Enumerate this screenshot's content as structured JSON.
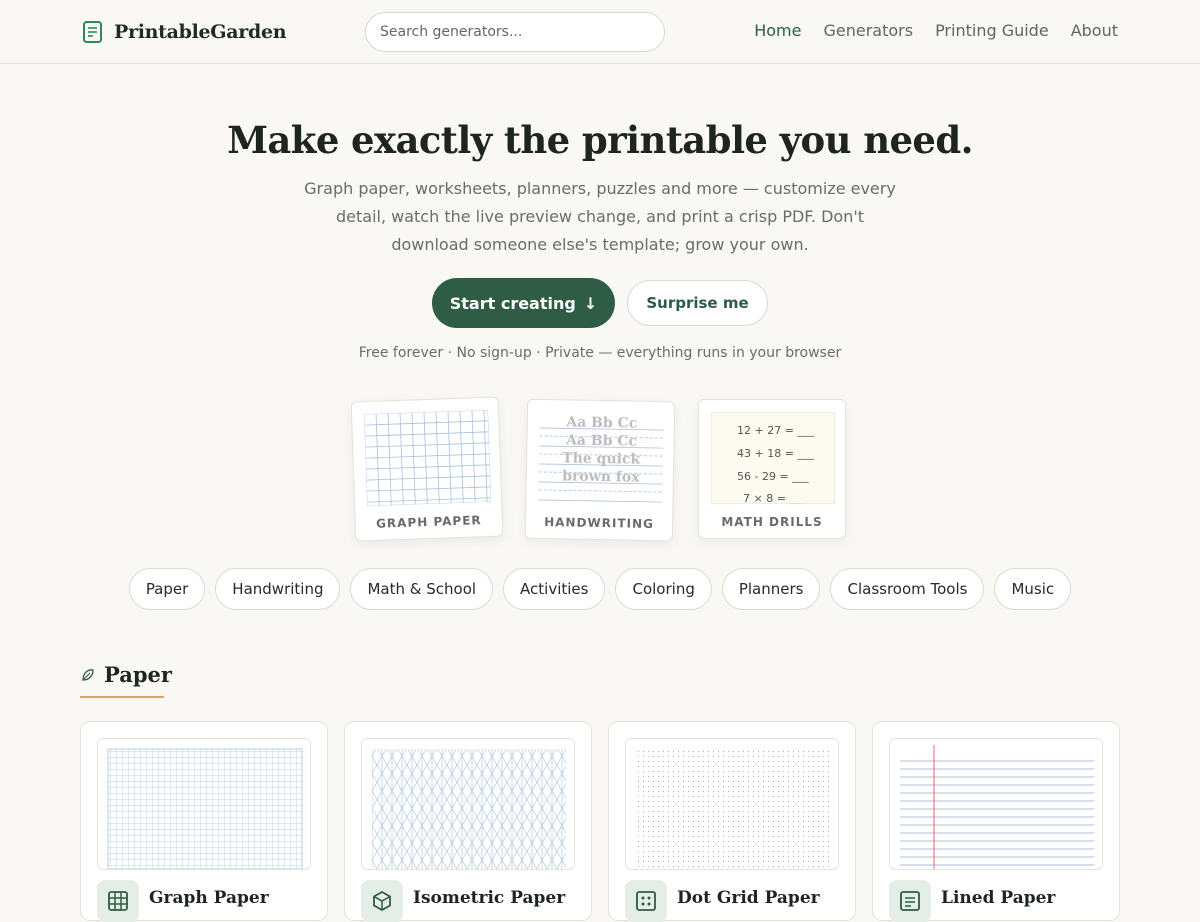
{
  "header": {
    "brand": "PrintableGarden",
    "search_placeholder": "Search generators...",
    "nav": [
      "Home",
      "Generators",
      "Printing Guide",
      "About"
    ],
    "active_nav": "Home"
  },
  "hero": {
    "title": "Make exactly the printable you need.",
    "subtitle": "Graph paper, worksheets, planners, puzzles and more — customize every detail, watch the live preview change, and print a crisp PDF. Don't download someone else's template; grow your own.",
    "primary_button": "Start creating",
    "primary_button_icon": "↓",
    "secondary_button": "Surprise me",
    "tagline": "Free forever · No sign-up · Private — everything runs in your browser"
  },
  "previews": [
    {
      "label": "GRAPH PAPER"
    },
    {
      "label": "HANDWRITING",
      "lines": [
        "Aa Bb Cc",
        "Aa Bb Cc",
        "The quick",
        "brown fox"
      ]
    },
    {
      "label": "MATH DRILLS",
      "lines": [
        "12 + 27 = ___",
        "43 + 18 = ___",
        "56 - 29 = ___",
        "7 × 8  =  ___"
      ]
    }
  ],
  "categories": [
    "Paper",
    "Handwriting",
    "Math & School",
    "Activities",
    "Coloring",
    "Planners",
    "Classroom Tools",
    "Music"
  ],
  "section": {
    "title": "Paper",
    "icon": "leaf-icon",
    "cards": [
      {
        "name": "Graph Paper",
        "icon": "grid-icon"
      },
      {
        "name": "Isometric Paper",
        "icon": "cube-icon"
      },
      {
        "name": "Dot Grid Paper",
        "icon": "dot-grid-icon"
      },
      {
        "name": "Lined Paper",
        "icon": "lined-icon"
      }
    ]
  },
  "colors": {
    "accent": "#2f5c45",
    "background": "#f9f8f5",
    "underline": "#d9a45c",
    "grid_line": "#a9c1dc",
    "margin_line": "#e07a86"
  }
}
